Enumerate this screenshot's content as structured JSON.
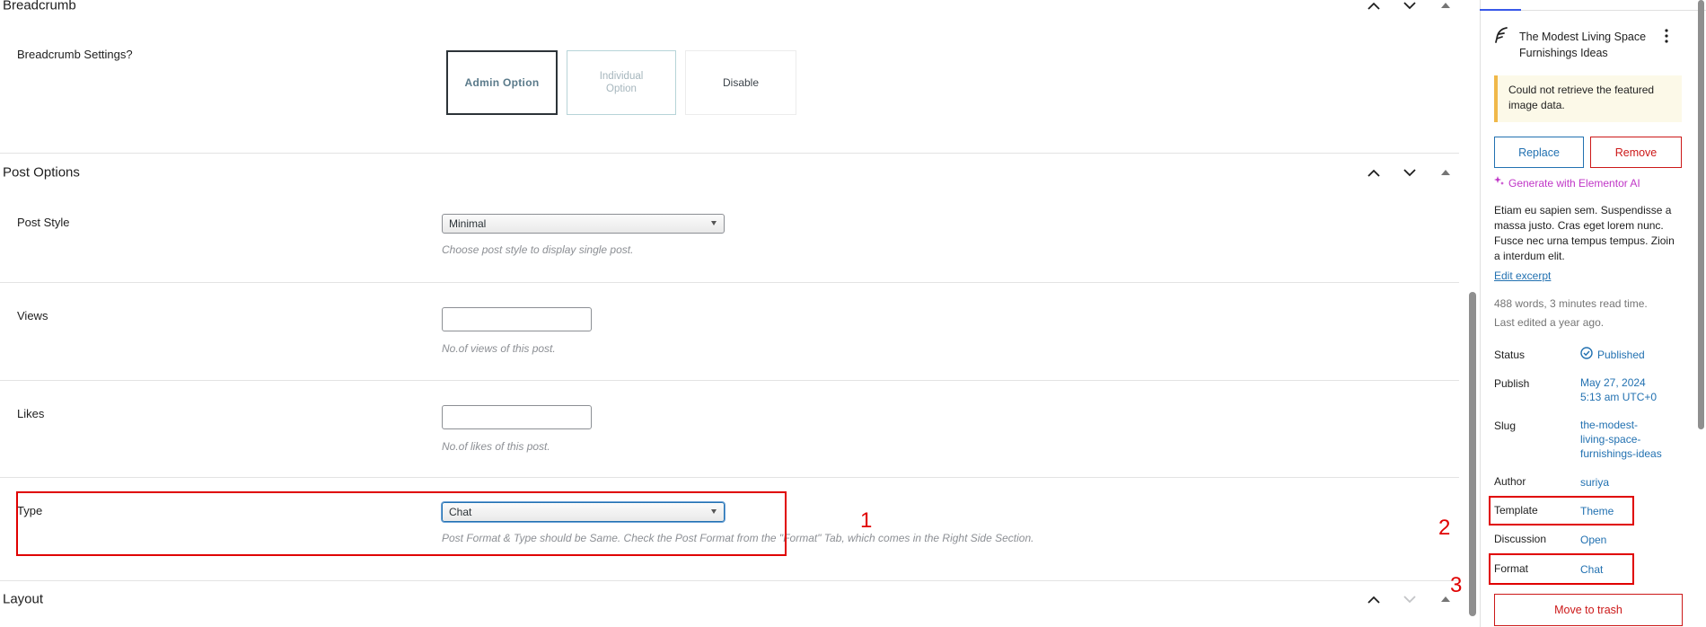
{
  "sections": {
    "breadcrumb": {
      "title": "Breadcrumb",
      "settings_label": "Breadcrumb Settings?",
      "options": {
        "admin": "Admin Option",
        "individual": "Individual Option",
        "disable": "Disable"
      }
    },
    "post_options": {
      "title": "Post Options",
      "post_style": {
        "label": "Post Style",
        "value": "Minimal",
        "description": "Choose post style to display single post."
      },
      "views": {
        "label": "Views",
        "value": "",
        "description": "No.of views of this post."
      },
      "likes": {
        "label": "Likes",
        "value": "",
        "description": "No.of likes of this post."
      },
      "type": {
        "label": "Type",
        "value": "Chat",
        "description": "Post Format & Type should be Same. Check the Post Format from the \"Format\" Tab, which comes in the Right Side Section."
      }
    },
    "layout": {
      "title": "Layout"
    }
  },
  "annotations": {
    "one": "1",
    "two": "2",
    "three": "3"
  },
  "sidebar": {
    "post_title": "The Modest Living Space Furnishings Ideas",
    "notice": "Could not retrieve the featured image data.",
    "replace_label": "Replace",
    "remove_label": "Remove",
    "generate_ai_label": "Generate with Elementor AI",
    "excerpt": "Etiam eu sapien sem. Suspendisse a massa justo. Cras eget lorem nunc. Fusce nec urna tempus tempus. Zioin a interdum elit.",
    "edit_excerpt_label": "Edit excerpt",
    "word_count": "488 words, 3 minutes read time.",
    "last_edited": "Last edited a year ago.",
    "fields": {
      "status": {
        "label": "Status",
        "value": "Published"
      },
      "publish": {
        "label": "Publish",
        "value_line1": "May 27, 2024",
        "value_line2": "5:13 am UTC+0"
      },
      "slug": {
        "label": "Slug",
        "value_line1": "the-modest-",
        "value_line2": "living-space-",
        "value_line3": "furnishings-ideas"
      },
      "author": {
        "label": "Author",
        "value": "suriya"
      },
      "template": {
        "label": "Template",
        "value": "Theme"
      },
      "discussion": {
        "label": "Discussion",
        "value": "Open"
      },
      "format": {
        "label": "Format",
        "value": "Chat"
      }
    },
    "trash_label": "Move to trash"
  },
  "colors": {
    "accent": "#2271b1",
    "danger": "#cc1818",
    "annotation_red": "#e00000",
    "ai_purple": "#c036c7",
    "notice_border": "#f0b849"
  }
}
